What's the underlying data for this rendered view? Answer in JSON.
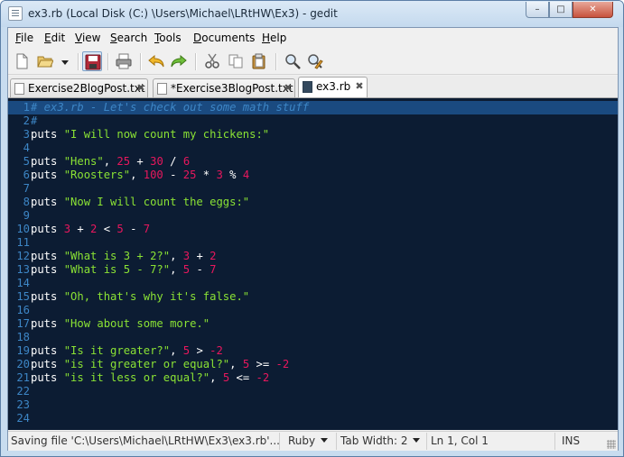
{
  "window": {
    "title": "ex3.rb (Local Disk (C:) \\Users\\Michael\\LRtHW\\Ex3) - gedit",
    "minimize": "–",
    "maximize": "□",
    "close": "✕"
  },
  "menu": {
    "items": [
      {
        "label": "File",
        "underline": "F"
      },
      {
        "label": "Edit",
        "underline": "E"
      },
      {
        "label": "View",
        "underline": "V"
      },
      {
        "label": "Search",
        "underline": "S"
      },
      {
        "label": "Tools",
        "underline": "T"
      },
      {
        "label": "Documents",
        "underline": "D"
      },
      {
        "label": "Help",
        "underline": "H"
      }
    ]
  },
  "toolbar": {
    "icons": [
      "new-document-icon",
      "open-folder-icon",
      "open-recent-dropdown-icon",
      "save-icon",
      "print-icon",
      "undo-icon",
      "redo-icon",
      "cut-icon",
      "copy-icon",
      "paste-icon",
      "find-icon",
      "find-replace-icon"
    ]
  },
  "tabs": [
    {
      "label": "Exercise2BlogPost.txt",
      "active": false,
      "close": "✖"
    },
    {
      "label": "*Exercise3BlogPost.txt",
      "active": false,
      "close": "✖"
    },
    {
      "label": "ex3.rb",
      "active": true,
      "close": "✖"
    }
  ],
  "editor": {
    "current_line": 1,
    "colors": {
      "background": "#0c1c33",
      "current_line": "#1a4a80",
      "line_numbers": "#3d86c6",
      "string": "#8ae234",
      "number": "#e8175d",
      "comment": "#3d86c6",
      "plain": "#ffffff"
    },
    "lines": [
      {
        "num": "1",
        "tokens": [
          {
            "t": "# ex3.rb - Let's check out some math stuff",
            "k": "cmt"
          }
        ]
      },
      {
        "num": "2",
        "tokens": [
          {
            "t": "#",
            "k": "cmt"
          }
        ]
      },
      {
        "num": "3",
        "tokens": [
          {
            "t": "puts ",
            "k": "plain"
          },
          {
            "t": "\"I will now count my chickens:\"",
            "k": "str"
          }
        ]
      },
      {
        "num": "4",
        "tokens": []
      },
      {
        "num": "5",
        "tokens": [
          {
            "t": "puts ",
            "k": "plain"
          },
          {
            "t": "\"Hens\"",
            "k": "str"
          },
          {
            "t": ", ",
            "k": "plain"
          },
          {
            "t": "25",
            "k": "num"
          },
          {
            "t": " + ",
            "k": "op"
          },
          {
            "t": "30",
            "k": "num"
          },
          {
            "t": " / ",
            "k": "op"
          },
          {
            "t": "6",
            "k": "num"
          }
        ]
      },
      {
        "num": "6",
        "tokens": [
          {
            "t": "puts ",
            "k": "plain"
          },
          {
            "t": "\"Roosters\"",
            "k": "str"
          },
          {
            "t": ", ",
            "k": "plain"
          },
          {
            "t": "100",
            "k": "num"
          },
          {
            "t": " - ",
            "k": "op"
          },
          {
            "t": "25",
            "k": "num"
          },
          {
            "t": " * ",
            "k": "op"
          },
          {
            "t": "3",
            "k": "num"
          },
          {
            "t": " % ",
            "k": "op"
          },
          {
            "t": "4",
            "k": "num"
          }
        ]
      },
      {
        "num": "7",
        "tokens": []
      },
      {
        "num": "8",
        "tokens": [
          {
            "t": "puts ",
            "k": "plain"
          },
          {
            "t": "\"Now I will count the eggs:\"",
            "k": "str"
          }
        ]
      },
      {
        "num": "9",
        "tokens": []
      },
      {
        "num": "10",
        "tokens": [
          {
            "t": "puts ",
            "k": "plain"
          },
          {
            "t": "3",
            "k": "num"
          },
          {
            "t": " + ",
            "k": "op"
          },
          {
            "t": "2",
            "k": "num"
          },
          {
            "t": " < ",
            "k": "op"
          },
          {
            "t": "5",
            "k": "num"
          },
          {
            "t": " - ",
            "k": "op"
          },
          {
            "t": "7",
            "k": "num"
          }
        ]
      },
      {
        "num": "11",
        "tokens": []
      },
      {
        "num": "12",
        "tokens": [
          {
            "t": "puts ",
            "k": "plain"
          },
          {
            "t": "\"What is 3 + 2?\"",
            "k": "str"
          },
          {
            "t": ", ",
            "k": "plain"
          },
          {
            "t": "3",
            "k": "num"
          },
          {
            "t": " + ",
            "k": "op"
          },
          {
            "t": "2",
            "k": "num"
          }
        ]
      },
      {
        "num": "13",
        "tokens": [
          {
            "t": "puts ",
            "k": "plain"
          },
          {
            "t": "\"What is 5 - 7?\"",
            "k": "str"
          },
          {
            "t": ", ",
            "k": "plain"
          },
          {
            "t": "5",
            "k": "num"
          },
          {
            "t": " - ",
            "k": "op"
          },
          {
            "t": "7",
            "k": "num"
          }
        ]
      },
      {
        "num": "14",
        "tokens": []
      },
      {
        "num": "15",
        "tokens": [
          {
            "t": "puts ",
            "k": "plain"
          },
          {
            "t": "\"Oh, that's why it's false.\"",
            "k": "str"
          }
        ]
      },
      {
        "num": "16",
        "tokens": []
      },
      {
        "num": "17",
        "tokens": [
          {
            "t": "puts ",
            "k": "plain"
          },
          {
            "t": "\"How about some more.\"",
            "k": "str"
          }
        ]
      },
      {
        "num": "18",
        "tokens": []
      },
      {
        "num": "19",
        "tokens": [
          {
            "t": "puts ",
            "k": "plain"
          },
          {
            "t": "\"Is it greater?\"",
            "k": "str"
          },
          {
            "t": ", ",
            "k": "plain"
          },
          {
            "t": "5",
            "k": "num"
          },
          {
            "t": " > ",
            "k": "op"
          },
          {
            "t": "-2",
            "k": "num"
          }
        ]
      },
      {
        "num": "20",
        "tokens": [
          {
            "t": "puts ",
            "k": "plain"
          },
          {
            "t": "\"is it greater or equal?\"",
            "k": "str"
          },
          {
            "t": ", ",
            "k": "plain"
          },
          {
            "t": "5",
            "k": "num"
          },
          {
            "t": " >= ",
            "k": "op"
          },
          {
            "t": "-2",
            "k": "num"
          }
        ]
      },
      {
        "num": "21",
        "tokens": [
          {
            "t": "puts ",
            "k": "plain"
          },
          {
            "t": "\"is it less or equal?\"",
            "k": "str"
          },
          {
            "t": ", ",
            "k": "plain"
          },
          {
            "t": "5",
            "k": "num"
          },
          {
            "t": " <= ",
            "k": "op"
          },
          {
            "t": "-2",
            "k": "num"
          }
        ]
      },
      {
        "num": "22",
        "tokens": []
      },
      {
        "num": "23",
        "tokens": []
      },
      {
        "num": "24",
        "tokens": []
      }
    ]
  },
  "status": {
    "message": "Saving file 'C:\\Users\\Michael\\LRtHW\\Ex3\\ex3.rb'...",
    "language": "Ruby",
    "tab_width": "Tab Width:  2",
    "position": "Ln 1, Col 1",
    "mode": "INS"
  }
}
